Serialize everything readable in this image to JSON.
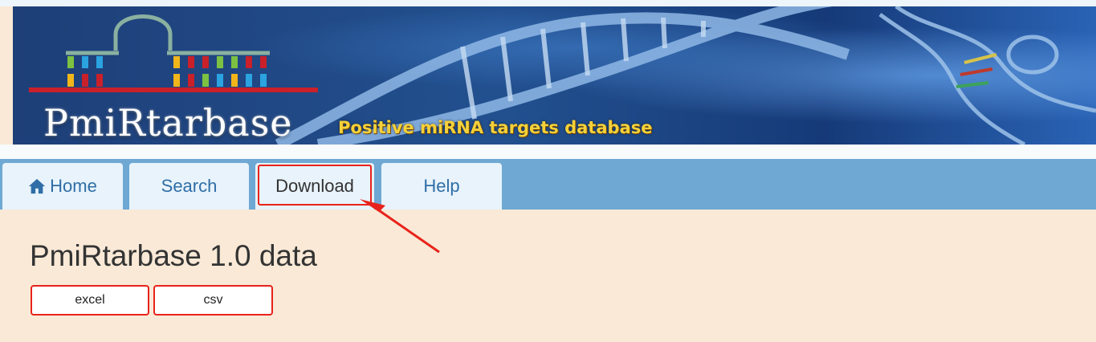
{
  "banner": {
    "logo_text": "PmiRtarbase",
    "tagline": "Positive miRNA targets database"
  },
  "nav": {
    "tabs": [
      {
        "label": "Home",
        "icon": "home-icon"
      },
      {
        "label": "Search"
      },
      {
        "label": "Download",
        "highlighted": true
      },
      {
        "label": "Help"
      }
    ]
  },
  "main": {
    "title": "PmiRtarbase 1.0 data",
    "buttons": [
      {
        "label": "excel"
      },
      {
        "label": "csv"
      }
    ]
  },
  "colors": {
    "page_background": "#f9e9d6",
    "navbar": "#6fa8d3",
    "tab_background": "#e8f3fb",
    "tab_link_text": "#2f6ea6",
    "highlight_annotation": "#e8231b",
    "tagline": "#f4d13a",
    "banner_dark": "#1d3f7a"
  }
}
